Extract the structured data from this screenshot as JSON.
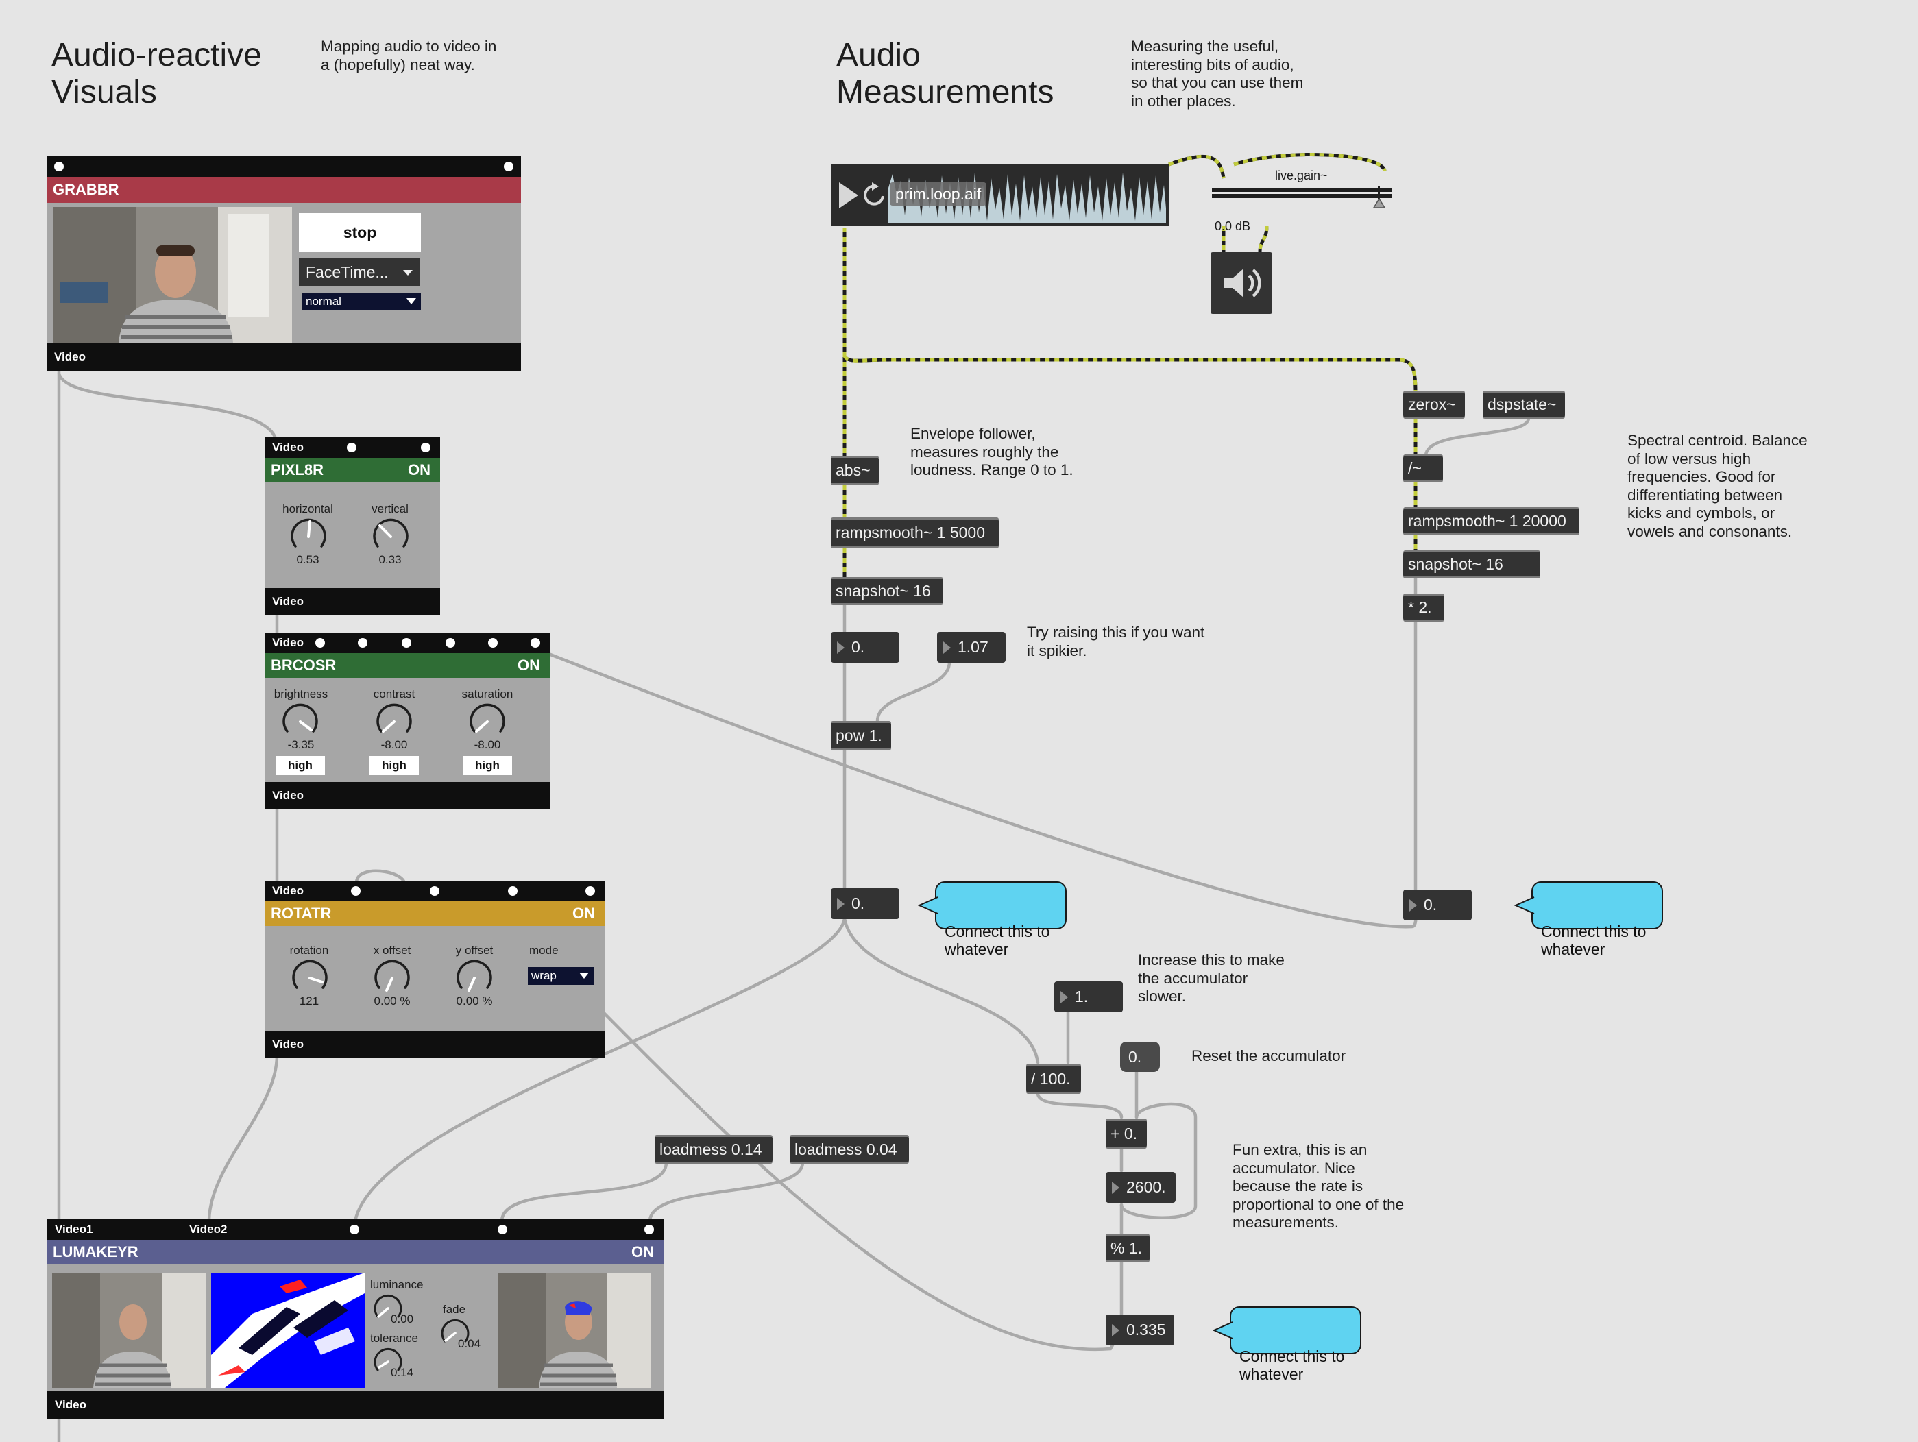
{
  "left_title": "Audio-reactive\nVisuals",
  "left_note": "Mapping audio to video in\na (hopefully) neat way.",
  "right_title": "Audio\nMeasurements",
  "right_note": "Measuring the useful,\ninteresting bits of audio,\nso that you can use them\nin other places.",
  "grabbr": {
    "name": "GRABBR",
    "stop_label": "stop",
    "device": "FaceTime...",
    "mode": "normal",
    "out_label": "Video"
  },
  "pixl8r": {
    "in_label": "Video",
    "name": "PIXL8R",
    "state": "ON",
    "dials": [
      {
        "label": "horizontal",
        "value": "0.53"
      },
      {
        "label": "vertical",
        "value": "0.33"
      }
    ],
    "out_label": "Video"
  },
  "brcosr": {
    "in_label": "Video",
    "name": "BRCOSR",
    "state": "ON",
    "dials": [
      {
        "label": "brightness",
        "value": "-3.35",
        "button": "high"
      },
      {
        "label": "contrast",
        "value": "-8.00",
        "button": "high"
      },
      {
        "label": "saturation",
        "value": "-8.00",
        "button": "high"
      }
    ],
    "out_label": "Video"
  },
  "rotatr": {
    "in_label": "Video",
    "name": "ROTATR",
    "state": "ON",
    "dials": [
      {
        "label": "rotation",
        "value": "121"
      },
      {
        "label": "x offset",
        "value": "0.00 %"
      },
      {
        "label": "y offset",
        "value": "0.00 %"
      }
    ],
    "mode_label": "mode",
    "mode_value": "wrap",
    "out_label": "Video"
  },
  "lumakeyr": {
    "in1_label": "Video1",
    "in2_label": "Video2",
    "name": "LUMAKEYR",
    "state": "ON",
    "luminance_label": "luminance",
    "luminance_value": "0.00",
    "tolerance_label": "tolerance",
    "tolerance_value": "0.14",
    "fade_label": "fade",
    "fade_value": "0.04",
    "out_label": "Video"
  },
  "player": {
    "file": "prim.loop.aif"
  },
  "gain": {
    "label": "live.gain~",
    "value": "0.0 dB"
  },
  "objects": {
    "abs": "abs~",
    "ramp1": "rampsmooth~ 1 5000",
    "snap1": "snapshot~ 16",
    "pow": "pow 1.",
    "zerox": "zerox~",
    "dspstate": "dspstate~",
    "div": "/~",
    "ramp2": "rampsmooth~ 1 20000",
    "snap2": "snapshot~ 16",
    "mul": "* 2.",
    "div100": "/ 100.",
    "plus": "+ 0.",
    "mod": "% 1.",
    "loadmess1": "loadmess 0.14",
    "loadmess2": "loadmess 0.04"
  },
  "numbers": {
    "n_in": "0.",
    "exponent": "1.07",
    "env_out": "0.",
    "centroid_out": "0.",
    "rate": "1.",
    "accum": "2600.",
    "accum_out": "0.335"
  },
  "reset_msg": "0.",
  "notes": {
    "envelope": "Envelope follower,\nmeasures roughly the\nloudness. Range 0 to 1.",
    "spiky": "Try raising this if you want\nit spikier.",
    "centroid": "Spectral centroid. Balance\nof low versus high\nfrequencies. Good for\ndifferentiating between\nkicks and cymbols, or\nvowels and consonants.",
    "increase": "Increase this to make\nthe accumulator\nslower.",
    "reset": "Reset the accumulator",
    "fun": "Fun extra, this is an\naccumulator. Nice\nbecause the rate is\nproportional to one of the\nmeasurements."
  },
  "callouts": {
    "c1": "Connect this to\nwhatever",
    "c2": "Connect this to\nwhatever",
    "c3": "Connect this to\nwhatever"
  },
  "colors": {
    "grabbr": "#a93a48",
    "pixl8r": "#2f6d35",
    "brcosr": "#2f6d35",
    "rotatr": "#c99b2b",
    "lumakeyr": "#5b5f90",
    "callout": "#5fd3f1",
    "audio_cable": "#c2cc3c"
  }
}
